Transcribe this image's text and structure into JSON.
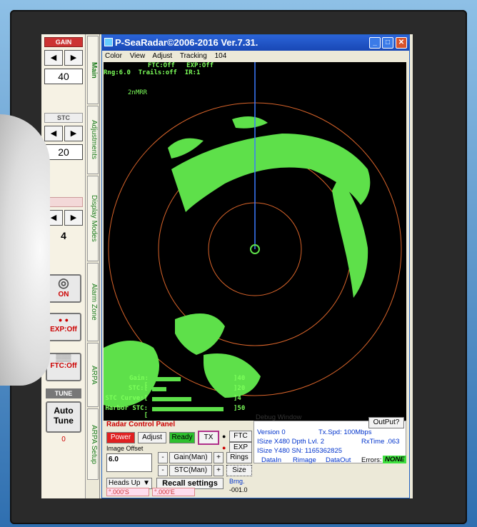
{
  "window": {
    "title": "P-SeaRadar©2006-2016 Ver.7.31.",
    "menu": [
      "Color",
      "View",
      "Adjust",
      "Tracking",
      "104"
    ]
  },
  "strip": {
    "gain_value": "40",
    "stc_value": "20",
    "stc_curve_value": "4",
    "gain_label": "GAIN",
    "stc_label": "STC",
    "on_label": "ON",
    "exp_label": "EXP:Off",
    "ftc_label": "FTC:Off",
    "tune_label": "TUNE",
    "auto_tune_label": "Auto Tune",
    "auto_tune_value": "0"
  },
  "tabs": [
    "Main",
    "Adjustments",
    "Display Modes",
    "Alarm Zone",
    "ARPA",
    "ARPA Setup"
  ],
  "radar": {
    "status_line1": "FTC:Off   EXP:Off",
    "status_line2": "Rng:6.0  Trails:off  IR:1",
    "range_ring_label": "2nMRR",
    "readouts": [
      {
        "label": "Gain:[",
        "bar": 0.45,
        "value": "]40"
      },
      {
        "label": "STC:[",
        "bar": 0.2,
        "value": "]20"
      },
      {
        "label": "STC Curve:[",
        "bar": 0.6,
        "value": "]4"
      },
      {
        "label": "Harbor STC:[",
        "bar": 0.85,
        "value": "]50"
      }
    ],
    "colors": {
      "echo": "#5ee04a",
      "ring": "#d9642a",
      "heading": "#3a7bff"
    }
  },
  "panel": {
    "title": "Radar Control Panel",
    "power": "Power",
    "adjust": "Adjust",
    "ready": "Ready",
    "tx": "TX",
    "ftc": "FTC",
    "exp": "EXP",
    "image_offset_label": "Image Offset",
    "image_offset_value": "6.0",
    "gain_man": "Gain(Man)",
    "stc_man": "STC(Man)",
    "rings": "Rings",
    "size": "Size",
    "brng_label": "Brng.",
    "brng_value": "-001.0",
    "minus": "-",
    "plus": "+",
    "heads_up": "Heads Up",
    "recall": "Recall settings",
    "lat": "°.000'S",
    "lon": "°.000'E"
  },
  "debug": {
    "title": "Debug Window",
    "output": "OutPut?",
    "version": "Version 0",
    "txspd": "Tx.Spd: 100Mbps",
    "isizex": "ISize X480  Dpth Lvl. 2",
    "rxtime": "RxTime .063",
    "isizey": "ISize Y480  SN: 1165362825",
    "datain": "DataIn",
    "rimage": "Rimage",
    "dataout": "DataOut",
    "errors": "Errors:",
    "errors_value": "NONE"
  }
}
